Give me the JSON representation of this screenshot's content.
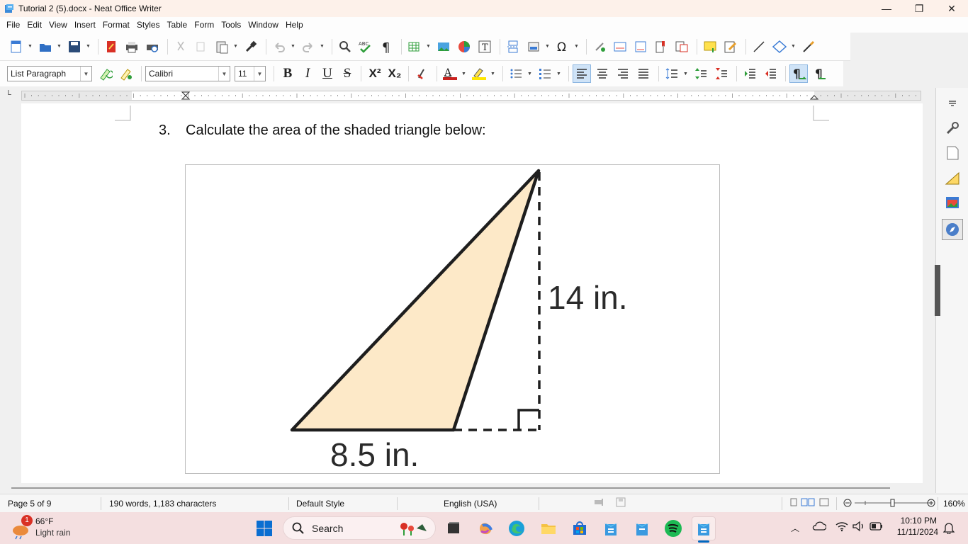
{
  "window": {
    "title": "Tutorial 2 (5).docx - Neat Office Writer",
    "minimize": "—",
    "restore": "❐",
    "close": "✕"
  },
  "menu": [
    "File",
    "Edit",
    "View",
    "Insert",
    "Format",
    "Styles",
    "Table",
    "Form",
    "Tools",
    "Window",
    "Help"
  ],
  "format_bar": {
    "paragraph_style": "List Paragraph",
    "font_name": "Calibri",
    "font_size": "11",
    "bold": "B",
    "italic": "I",
    "underline": "U",
    "strike": "S",
    "superscript": "X²",
    "subscript": "X₂"
  },
  "document": {
    "question_number": "3.",
    "question_text": "Calculate the area of the shaded triangle below:",
    "figure": {
      "base_label": "8.5 in.",
      "height_label": "14 in.",
      "fill_color": "#fde9c8",
      "stroke_color": "#1e1e1e"
    }
  },
  "status": {
    "page": "Page 5 of 9",
    "words": "190 words, 1,183 characters",
    "page_style": "Default Style",
    "language": "English (USA)",
    "zoom": "160%"
  },
  "taskbar": {
    "weather_temp": "66°F",
    "weather_desc": "Light rain",
    "weather_badge": "1",
    "search_placeholder": "Search",
    "time": "10:10 PM",
    "date": "11/11/2024"
  },
  "colors": {
    "accent": "#0067c0",
    "taskbar_bg": "#f4dfe0",
    "triangle_fill": "#fde9c8"
  }
}
